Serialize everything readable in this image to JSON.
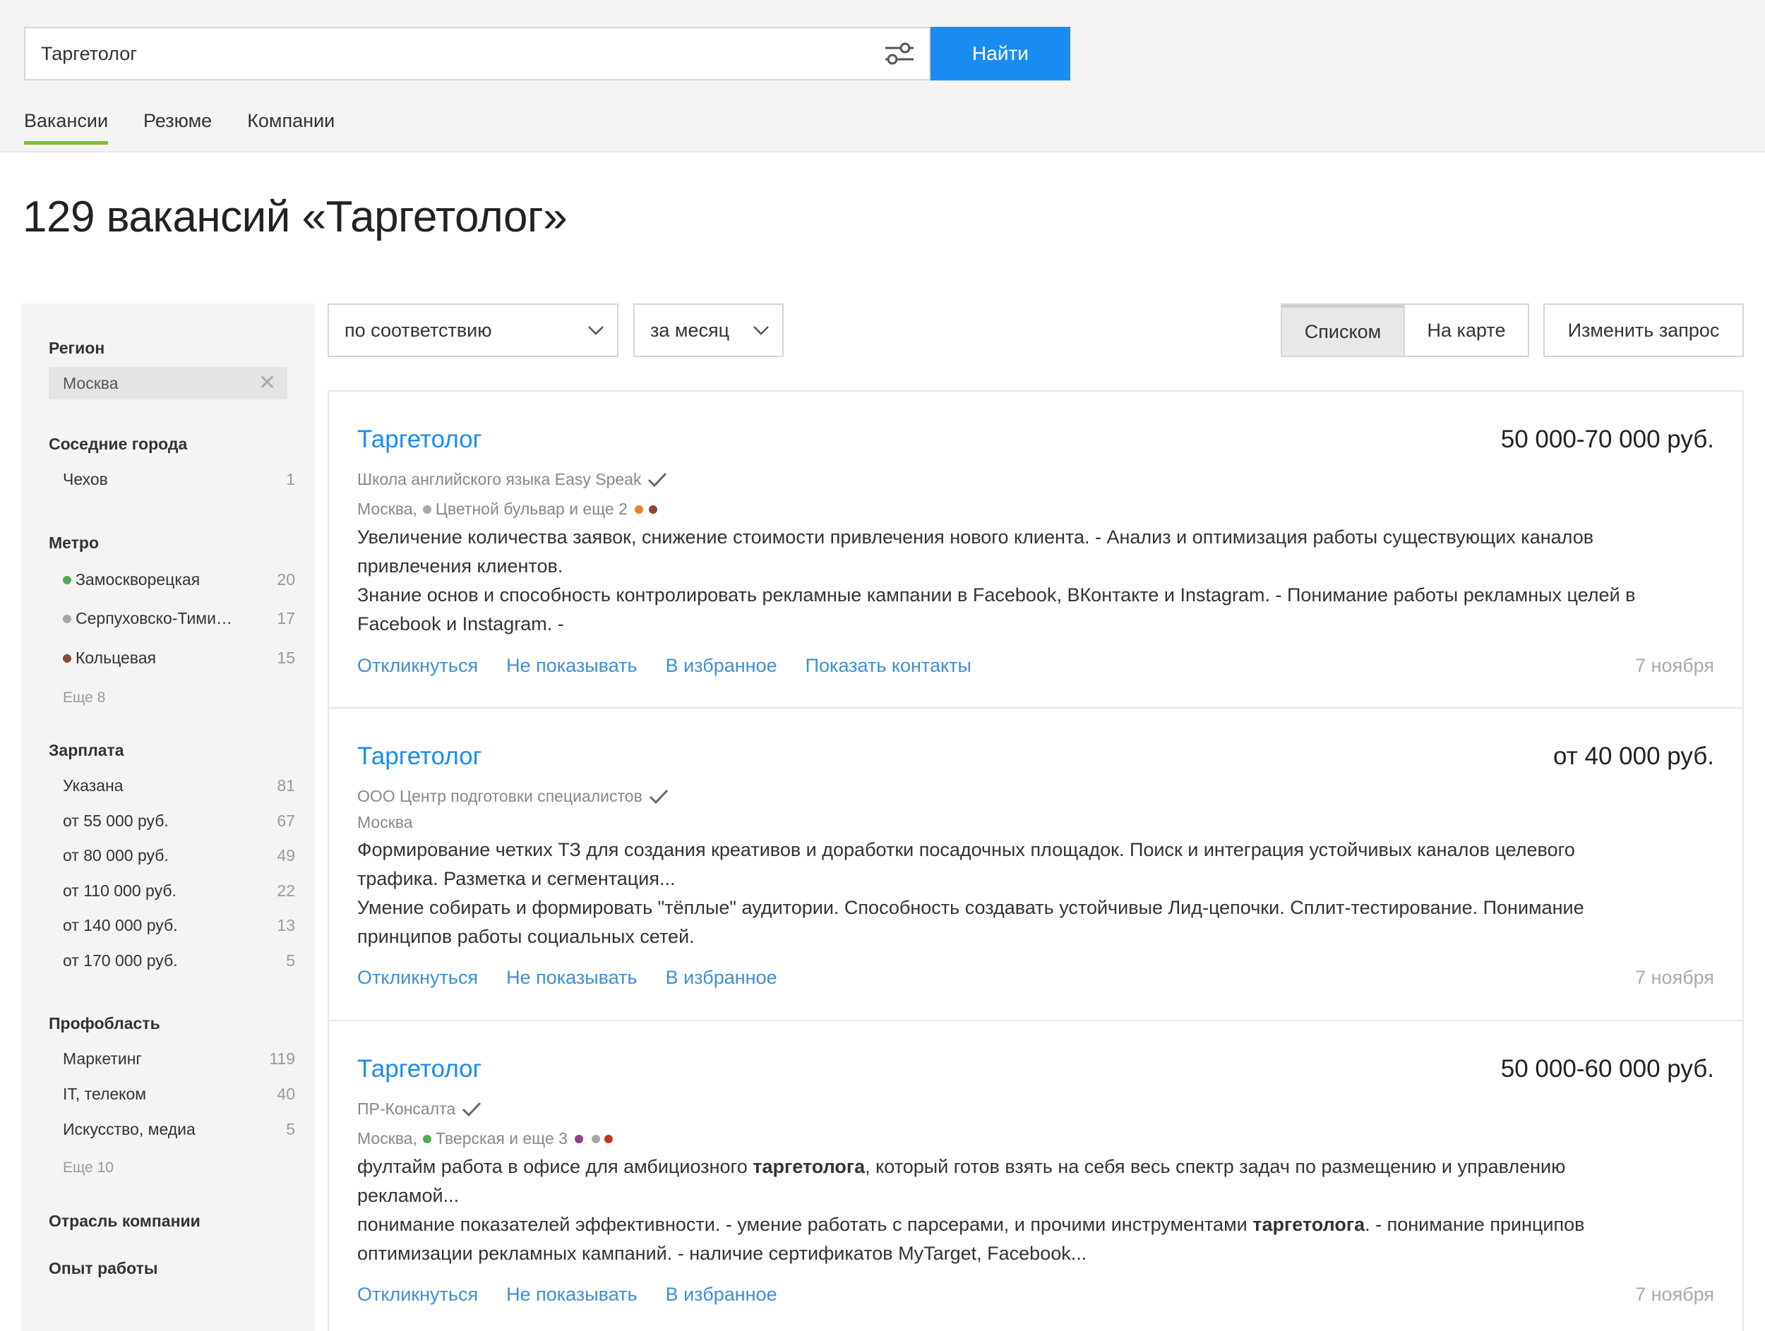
{
  "search": {
    "query": "Таргетолог",
    "button_label": "Найти"
  },
  "tabs": [
    "Вакансии",
    "Резюме",
    "Компании"
  ],
  "page_title": "129 вакансий «Таргетолог»",
  "sidebar": {
    "region": {
      "heading": "Регион",
      "value": "Москва"
    },
    "nearby": {
      "heading": "Соседние города",
      "items": [
        {
          "label": "Чехов",
          "count": "1"
        }
      ]
    },
    "metro": {
      "heading": "Метро",
      "items": [
        {
          "label": "Замоскворецкая",
          "count": "20",
          "color": "#4caf50"
        },
        {
          "label": "Серпуховско-Тими…",
          "count": "17",
          "color": "#a6a6a6"
        },
        {
          "label": "Кольцевая",
          "count": "15",
          "color": "#8d4a2f"
        }
      ],
      "more": "Еще 8"
    },
    "salary": {
      "heading": "Зарплата",
      "items": [
        {
          "label": "Указана",
          "count": "81"
        },
        {
          "label": "от 55 000 руб.",
          "count": "67"
        },
        {
          "label": "от 80 000 руб.",
          "count": "49"
        },
        {
          "label": "от 110 000 руб.",
          "count": "22"
        },
        {
          "label": "от 140 000 руб.",
          "count": "13"
        },
        {
          "label": "от 170 000 руб.",
          "count": "5"
        }
      ]
    },
    "prof": {
      "heading": "Профобласть",
      "items": [
        {
          "label": "Маркетинг",
          "count": "119"
        },
        {
          "label": "IT, телеком",
          "count": "40"
        },
        {
          "label": "Искусство, медиа",
          "count": "5"
        }
      ],
      "more": "Еще 10"
    },
    "industry_heading": "Отрасль компании",
    "experience_heading": "Опыт работы"
  },
  "toolbar": {
    "sort": "по соответствию",
    "period": "за месяц",
    "view_list": "Списком",
    "view_map": "На карте",
    "change_query": "Изменить запрос"
  },
  "vacancies": [
    {
      "title": "Таргетолог",
      "salary": "50 000-70 000 руб.",
      "company": "Школа английского языка Easy Speak",
      "city": "Москва,",
      "metro": "Цветной бульвар и еще 2",
      "desc1a": "Увеличение количества заявок, снижение стоимости привлечения нового клиента. - Анализ и оптимизация работы существующих каналов",
      "desc1b": "привлечения клиентов.",
      "desc2a": "Знание основ и способность контролировать рекламные кампании в Facebook, ВКонтакте и Instagram. - Понимание работы рекламных целей в",
      "desc2b": "Facebook и Instagram. -",
      "actions": [
        "Откликнуться",
        "Не показывать",
        "В избранное",
        "Показать контакты"
      ],
      "date": "7 ноября"
    },
    {
      "title": "Таргетолог",
      "salary": "от 40 000 руб.",
      "company": "ООО Центр подготовки специалистов",
      "city": "Москва",
      "desc1a": "Формирование четких ТЗ для создания креативов и доработки посадочных площадок. Поиск и интеграция устойчивых каналов целевого",
      "desc1b": "трафика. Разметка и сегментация...",
      "desc2a": "Умение собирать и формировать \"тёплые\" аудитории. Способность создавать устойчивые Лид-цепочки. Сплит-тестирование. Понимание",
      "desc2b": "принципов работы социальных сетей.",
      "actions": [
        "Откликнуться",
        "Не показывать",
        "В избранное"
      ],
      "date": "7 ноября"
    },
    {
      "title": "Таргетолог",
      "salary": "50 000-60 000 руб.",
      "company": "ПР-Консалта",
      "city": "Москва,",
      "metro": "Тверская и еще 3",
      "desc1a_pre": "фултайм работа в офисе для амбициозного ",
      "desc1a_bold": "таргетолога",
      "desc1a_post": ", который готов взять на себя весь спектр задач по размещению и управлению",
      "desc1b": "рекламой...",
      "desc2a_pre": "понимание показателей эффективности. - умение работать с парсерами, и прочими инструментами ",
      "desc2a_bold": "таргетолога",
      "desc2a_post": ". - понимание принципов",
      "desc2b": "оптимизации рекламных кампаний. - наличие сертификатов MyTarget, Facebook...",
      "actions": [
        "Откликнуться",
        "Не показывать",
        "В избранное"
      ],
      "date": "7 ноября"
    }
  ],
  "colors": {
    "accent_blue": "#1a8cf0",
    "link_blue": "#3d8fd6",
    "tab_underline": "#7fbf2a",
    "metro_green": "#4caf50",
    "metro_gray": "#a6a6a6",
    "metro_orange": "#e8822a",
    "metro_brown": "#8d4a2f",
    "metro_purple": "#9b3d8f"
  }
}
